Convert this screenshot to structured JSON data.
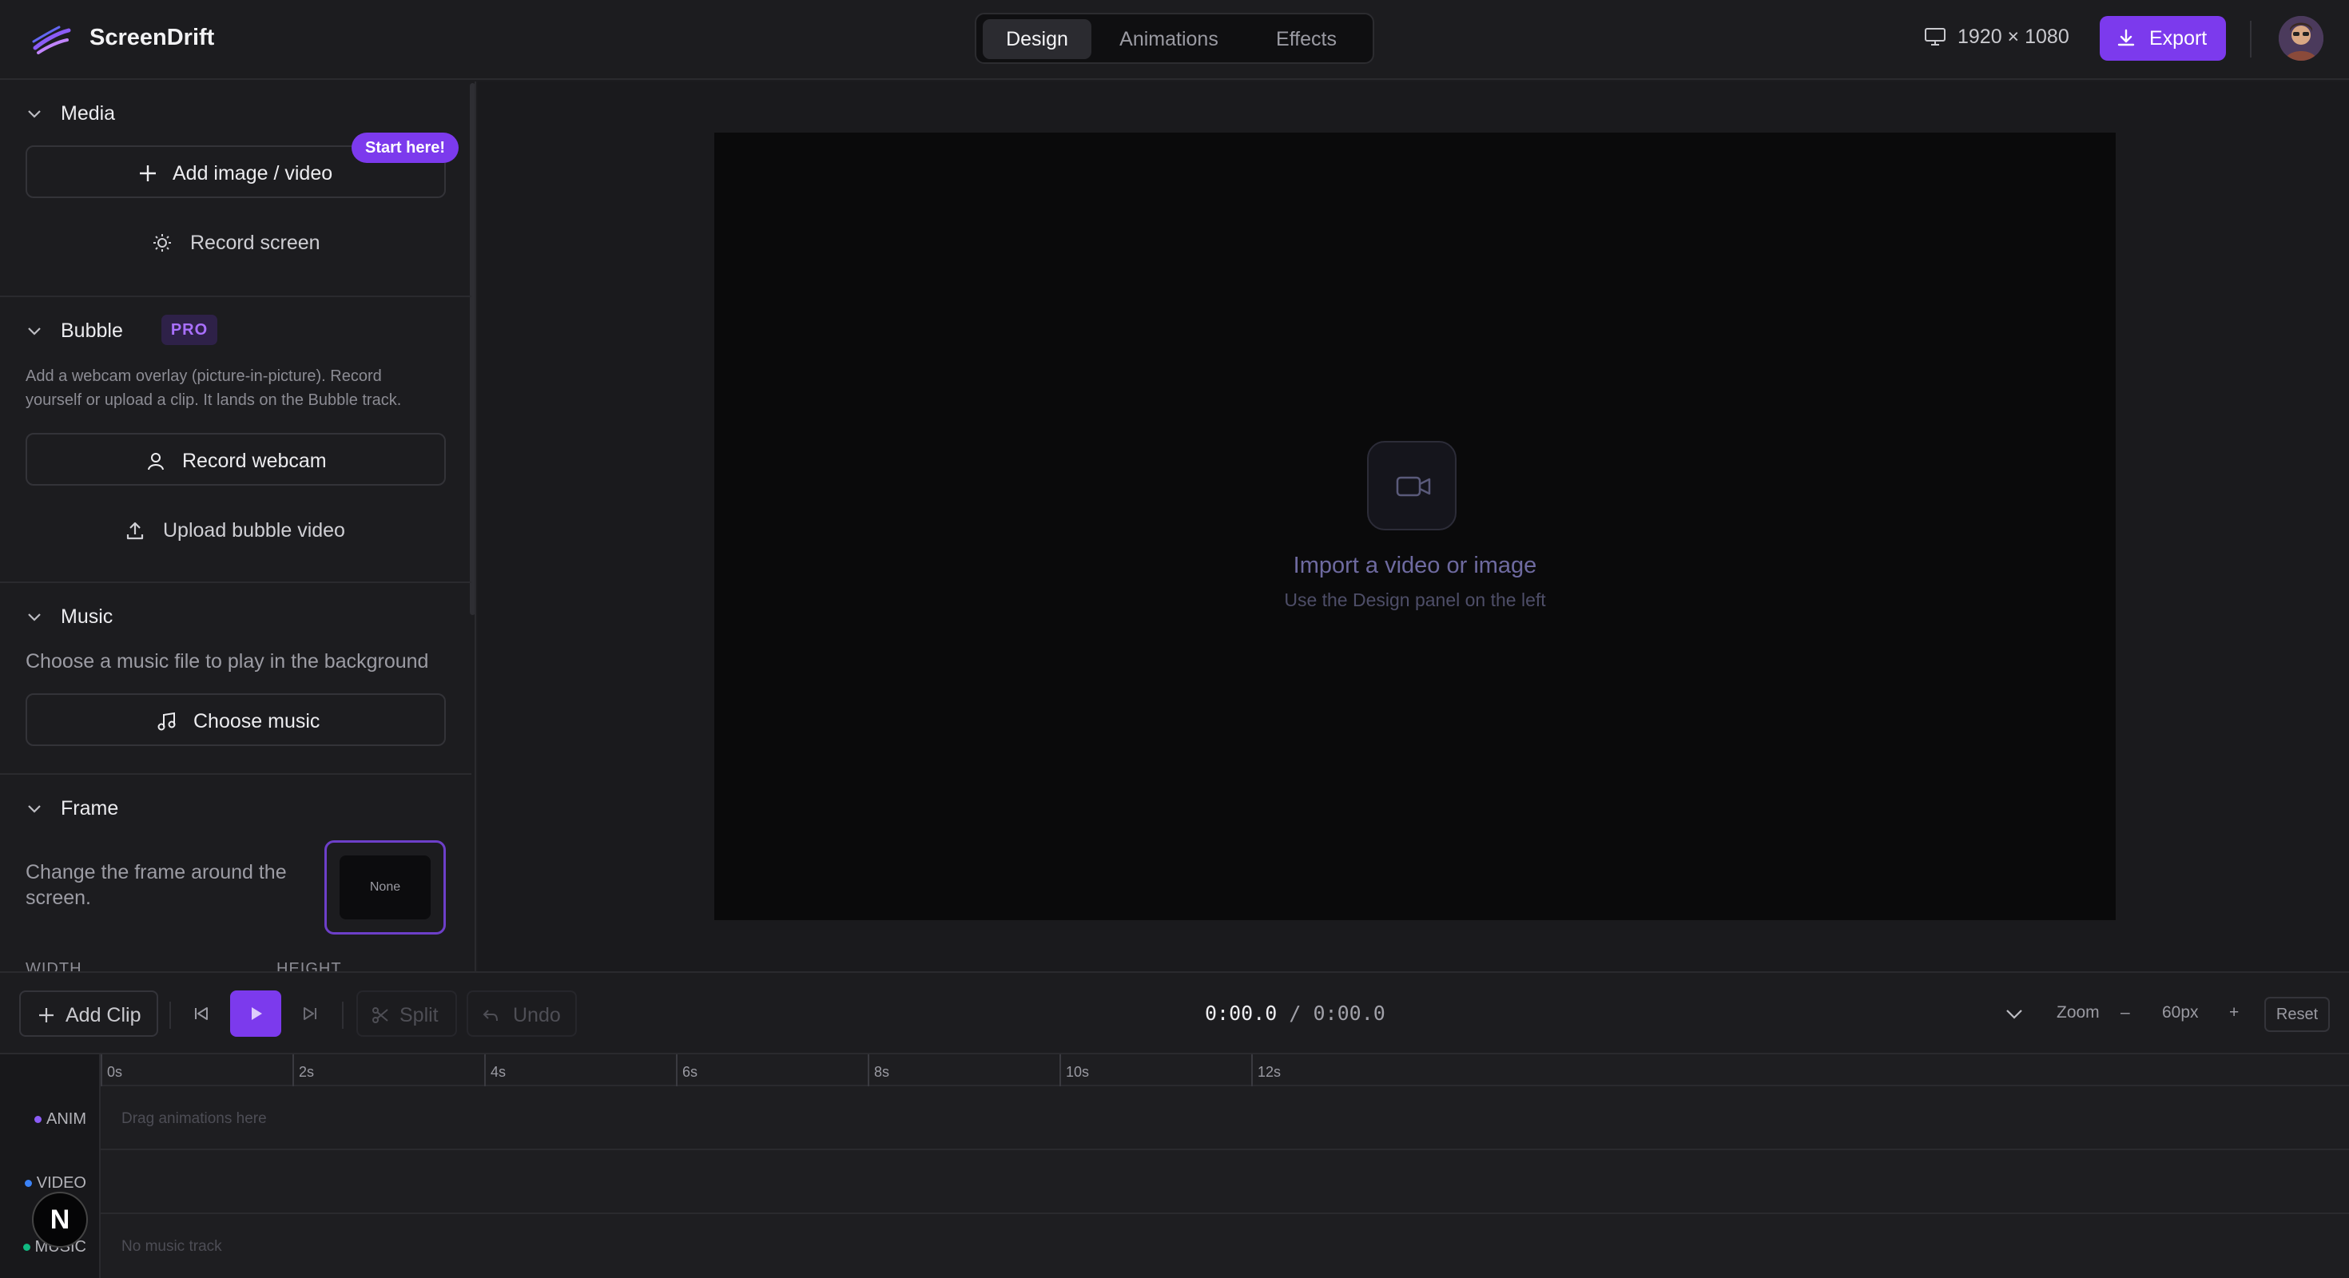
{
  "app": {
    "name": "ScreenDrift"
  },
  "header": {
    "tabs": [
      {
        "label": "Design",
        "active": true
      },
      {
        "label": "Animations",
        "active": false
      },
      {
        "label": "Effects",
        "active": false
      }
    ],
    "resolution": "1920 × 1080",
    "export_label": "Export",
    "accent_color": "#7c3aed"
  },
  "sidebar": {
    "media": {
      "title": "Media",
      "badge": "Start here!",
      "add_label": "Add image / video",
      "record_label": "Record screen"
    },
    "bubble": {
      "title": "Bubble",
      "badge": "PRO",
      "description": "Add a webcam overlay (picture-in-picture). Record yourself or upload a clip. It lands on the Bubble track.",
      "record_label": "Record webcam",
      "upload_label": "Upload bubble video"
    },
    "music": {
      "title": "Music",
      "description": "Choose a music file to play in the background",
      "choose_label": "Choose music"
    },
    "frame": {
      "title": "Frame",
      "description": "Change the frame around the screen.",
      "option_label": "None",
      "width_label": "WIDTH",
      "height_label": "HEIGHT"
    }
  },
  "canvas": {
    "title": "Import a video or image",
    "subtitle": "Use the Design panel on the left"
  },
  "timeline": {
    "add_clip_label": "Add Clip",
    "split_label": "Split",
    "undo_label": "Undo",
    "current_time": "0:00.0",
    "separator": "/",
    "duration": "0:00.0",
    "zoom_label": "Zoom",
    "zoom_minus": "–",
    "zoom_value": "60px",
    "zoom_plus": "+",
    "reset_label": "Reset",
    "ticks": [
      "0s",
      "2s",
      "4s",
      "6s",
      "8s",
      "10s",
      "12s"
    ],
    "tracks": [
      {
        "label": "ANIM",
        "color": "#8b5cf6",
        "hint": "Drag animations here"
      },
      {
        "label": "VIDEO",
        "color": "#3b82f6",
        "hint": ""
      },
      {
        "label": "MUSIC",
        "color": "#10b981",
        "hint": "No music track"
      }
    ]
  },
  "dev_badge": "N"
}
